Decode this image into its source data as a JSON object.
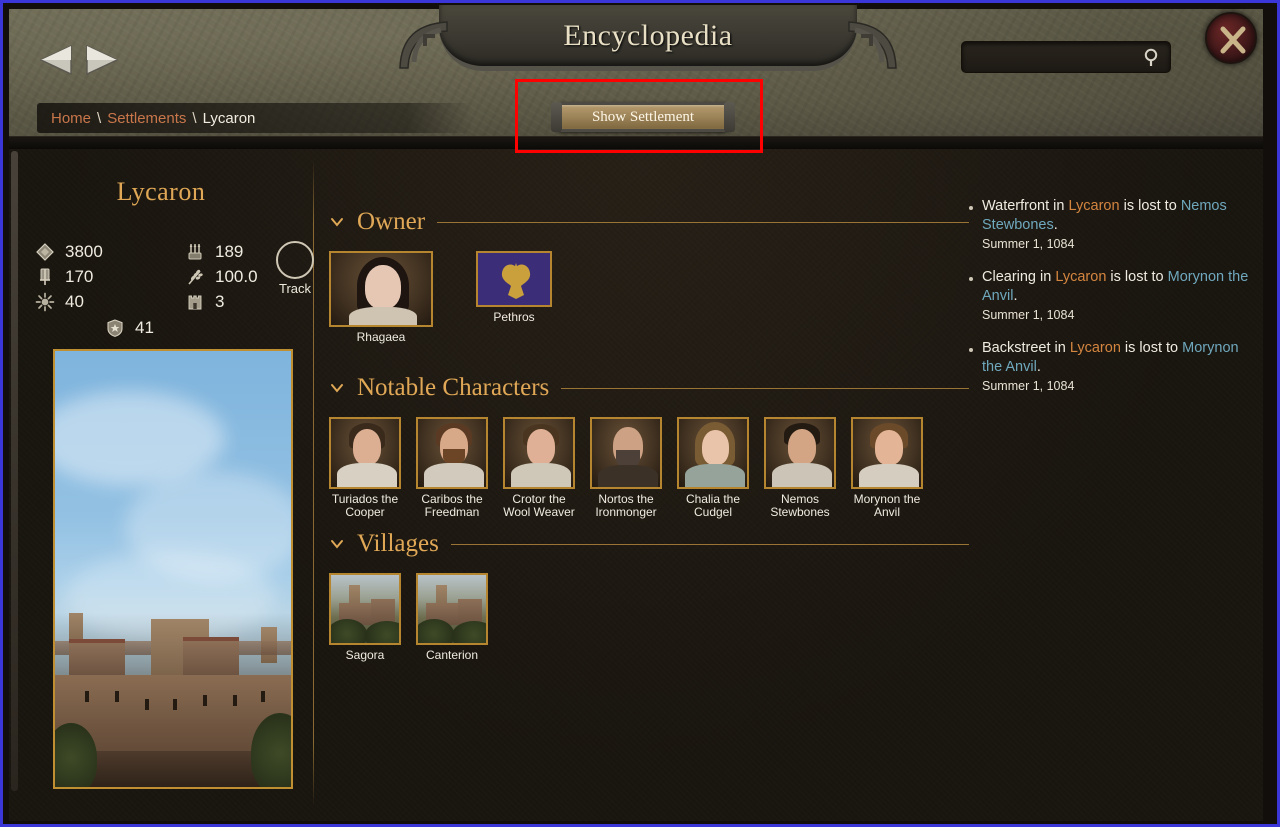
{
  "header": {
    "title": "Encyclopedia",
    "nav_back_icon": "arrow-left-icon",
    "nav_forward_icon": "arrow-right-icon",
    "close_icon": "close-x-icon",
    "search": {
      "value": "",
      "placeholder": "",
      "icon": "search-icon"
    },
    "show_settlement_label": "Show Settlement"
  },
  "breadcrumb": {
    "home": "Home",
    "sep1": "\\",
    "settlements": "Settlements",
    "sep2": "\\",
    "current": "Lycaron"
  },
  "left_panel": {
    "settlement_name": "Lycaron",
    "stats": [
      {
        "icon": "gem-prosperity-icon",
        "value": "3800"
      },
      {
        "icon": "militia-icon",
        "value": "170"
      },
      {
        "icon": "sun-loyalty-icon",
        "value": "40"
      },
      {
        "icon": "quiver-arrows-icon",
        "value": "189"
      },
      {
        "icon": "wheat-food-icon",
        "value": "100.0"
      },
      {
        "icon": "castle-icon",
        "value": "3"
      },
      {
        "icon": "shield-star-icon",
        "value": "41"
      }
    ],
    "track": {
      "label": "Track",
      "icon": "track-circle-icon"
    },
    "art_alt": "settlement-illustration"
  },
  "main": {
    "sections": [
      {
        "title": "Owner",
        "chevron": "chevron-down-icon",
        "items": [
          {
            "type": "character",
            "label": "Rhagaea"
          },
          {
            "type": "banner",
            "label": "Pethros"
          }
        ]
      },
      {
        "title": "Notable Characters",
        "chevron": "chevron-down-icon",
        "items": [
          {
            "type": "character",
            "label": "Turiados the\nCooper"
          },
          {
            "type": "character",
            "label": "Caribos the\nFreedman"
          },
          {
            "type": "character",
            "label": "Crotor the\nWool Weaver"
          },
          {
            "type": "character",
            "label": "Nortos the\nIronmonger"
          },
          {
            "type": "character",
            "label": "Chalia the\nCudgel"
          },
          {
            "type": "character",
            "label": "Nemos\nStewbones"
          },
          {
            "type": "character",
            "label": "Morynon the\nAnvil"
          }
        ]
      },
      {
        "title": "Villages",
        "chevron": "chevron-down-icon",
        "items": [
          {
            "type": "village",
            "label": "Sagora"
          },
          {
            "type": "village",
            "label": "Canterion"
          }
        ]
      }
    ]
  },
  "events": [
    {
      "parts": [
        {
          "t": "Waterfront in ",
          "k": "plain"
        },
        {
          "t": "Lycaron",
          "k": "place"
        },
        {
          "t": " is lost to ",
          "k": "plain"
        },
        {
          "t": "Nemos Stewbones",
          "k": "person"
        },
        {
          "t": ".",
          "k": "plain"
        }
      ],
      "date": "Summer 1, 1084"
    },
    {
      "parts": [
        {
          "t": "Clearing in ",
          "k": "plain"
        },
        {
          "t": "Lycaron",
          "k": "place"
        },
        {
          "t": " is lost to ",
          "k": "plain"
        },
        {
          "t": "Morynon the Anvil",
          "k": "person"
        },
        {
          "t": ".",
          "k": "plain"
        }
      ],
      "date": "Summer 1, 1084"
    },
    {
      "parts": [
        {
          "t": "Backstreet in ",
          "k": "plain"
        },
        {
          "t": "Lycaron",
          "k": "place"
        },
        {
          "t": " is lost to ",
          "k": "plain"
        },
        {
          "t": "Morynon the Anvil",
          "k": "person"
        },
        {
          "t": ".",
          "k": "plain"
        }
      ],
      "date": "Summer 1, 1084"
    }
  ],
  "colors": {
    "accent_gold": "#e0a856",
    "rule_gold": "#9a7434",
    "place": "#d4853f",
    "person": "#6fa8bd",
    "annotation": "#ff0000",
    "banner_purple": "#3b2d78"
  }
}
